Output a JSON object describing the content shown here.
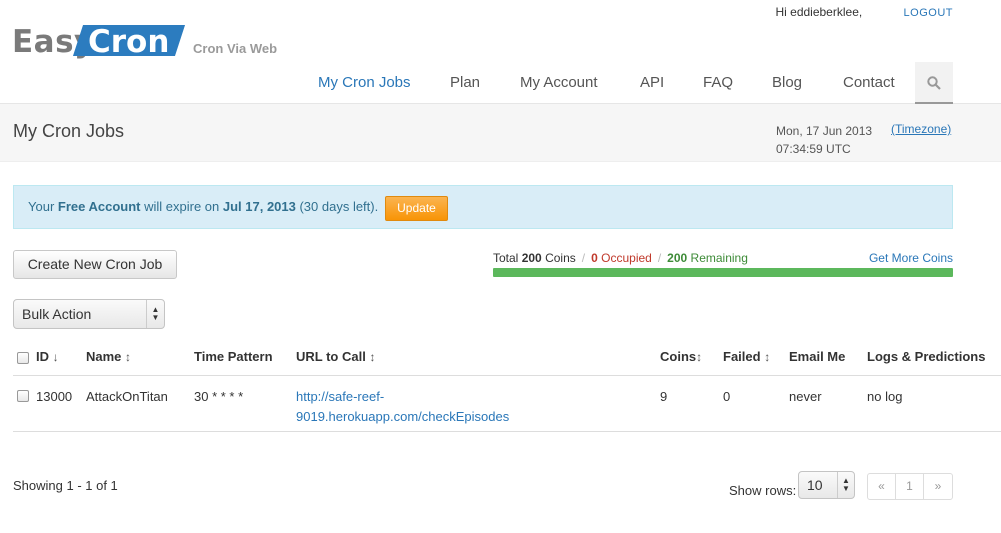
{
  "header": {
    "logo_easy": "Easy",
    "logo_cron": "Cron",
    "tagline": "Cron Via Web",
    "greeting": "Hi eddieberklee,",
    "logout": "LOGOUT",
    "nav": [
      {
        "label": "My Cron Jobs",
        "active": true
      },
      {
        "label": "Plan"
      },
      {
        "label": "My Account"
      },
      {
        "label": "API"
      },
      {
        "label": "FAQ"
      },
      {
        "label": "Blog"
      },
      {
        "label": "Contact"
      }
    ],
    "search_icon": "search-icon"
  },
  "page": {
    "title": "My Cron Jobs",
    "date": "Mon, 17 Jun 2013",
    "time": "07:34:59 UTC",
    "timezone_link": "(Timezone)"
  },
  "alert": {
    "prefix": "Your ",
    "account": "Free Account",
    "middle": " will expire on ",
    "date": "Jul 17, 2013",
    "suffix": " (30 days left).",
    "button": "Update"
  },
  "actions": {
    "create_button": "Create New Cron Job",
    "bulk_action": "Bulk Action"
  },
  "coins": {
    "total_label": "Total",
    "total_value": "200",
    "total_unit": "Coins",
    "occupied": "0 Occupied",
    "remaining": "200 Remaining",
    "get_more": "Get More Coins",
    "remaining_fraction": 1.0
  },
  "table": {
    "headers": {
      "id": "ID",
      "name": "Name",
      "time_pattern": "Time Pattern",
      "url": "URL to Call",
      "coins": "Coins",
      "failed": "Failed",
      "email": "Email Me",
      "logs": "Logs & Predictions"
    },
    "rows": [
      {
        "id": "13000",
        "name": "AttackOnTitan",
        "time_pattern": "30 * * * *",
        "url_line1": "http://safe-reef-",
        "url_line2": "9019.herokuapp.com/checkEpisodes",
        "coins": "9",
        "failed": "0",
        "email": "never",
        "logs": "no log"
      }
    ]
  },
  "footer": {
    "showing": "Showing 1 - 1 of 1",
    "rows_label": "Show rows:",
    "rows_value": "10",
    "pager_prev": "«",
    "pager_page": "1",
    "pager_next": "»"
  }
}
